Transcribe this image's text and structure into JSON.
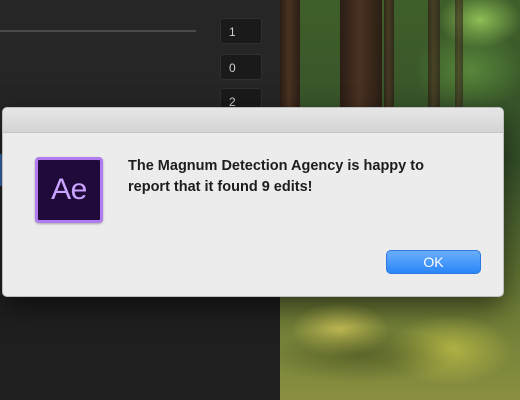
{
  "background_panel": {
    "fields": [
      "1",
      "0",
      "2"
    ]
  },
  "dialog": {
    "app_icon": {
      "icon": "after-effects-app-icon",
      "text": "Ae",
      "bg_color": "#1f0a3a",
      "accent_color": "#b07cf0"
    },
    "message_line1": "The Magnum Detection Agency is happy to",
    "message_line2": "report that it found 9 edits!",
    "ok_label": "OK",
    "ok_color": "#2a86f8"
  }
}
